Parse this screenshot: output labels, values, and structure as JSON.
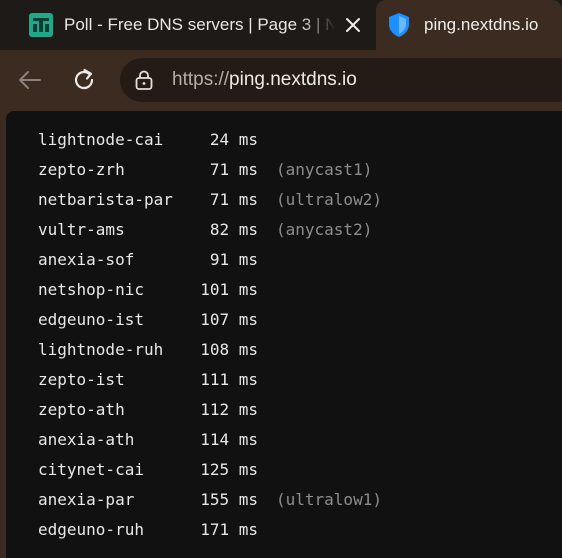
{
  "tabs": [
    {
      "title": "Poll - Free DNS servers | Page 3 | N",
      "active": false
    },
    {
      "title": "ping.nextdns.io",
      "active": true
    }
  ],
  "address": {
    "scheme": "https://",
    "host": "ping.nextdns.io"
  },
  "results": [
    {
      "host": "lightnode-cai",
      "latency": "24 ms",
      "note": ""
    },
    {
      "host": "zepto-zrh",
      "latency": "71 ms",
      "note": "(anycast1)"
    },
    {
      "host": "netbarista-par",
      "latency": "71 ms",
      "note": "(ultralow2)"
    },
    {
      "host": "vultr-ams",
      "latency": "82 ms",
      "note": "(anycast2)"
    },
    {
      "host": "anexia-sof",
      "latency": "91 ms",
      "note": ""
    },
    {
      "host": "netshop-nic",
      "latency": "101 ms",
      "note": ""
    },
    {
      "host": "edgeuno-ist",
      "latency": "107 ms",
      "note": ""
    },
    {
      "host": "lightnode-ruh",
      "latency": "108 ms",
      "note": ""
    },
    {
      "host": "zepto-ist",
      "latency": "111 ms",
      "note": ""
    },
    {
      "host": "zepto-ath",
      "latency": "112 ms",
      "note": ""
    },
    {
      "host": "anexia-ath",
      "latency": "114 ms",
      "note": ""
    },
    {
      "host": "citynet-cai",
      "latency": "125 ms",
      "note": ""
    },
    {
      "host": "anexia-par",
      "latency": "155 ms",
      "note": "(ultralow1)"
    },
    {
      "host": "edgeuno-ruh",
      "latency": "171 ms",
      "note": ""
    }
  ],
  "icons": {
    "inactive_tab_favicon": "poll-site-icon",
    "active_tab_favicon": "shield-icon",
    "tab_close": "close-icon",
    "back": "back-arrow-icon",
    "reload": "reload-icon",
    "site_info": "lock-icon"
  },
  "colors": {
    "accent": "#1f8fff",
    "poll_favicon": "#1fa88a"
  }
}
